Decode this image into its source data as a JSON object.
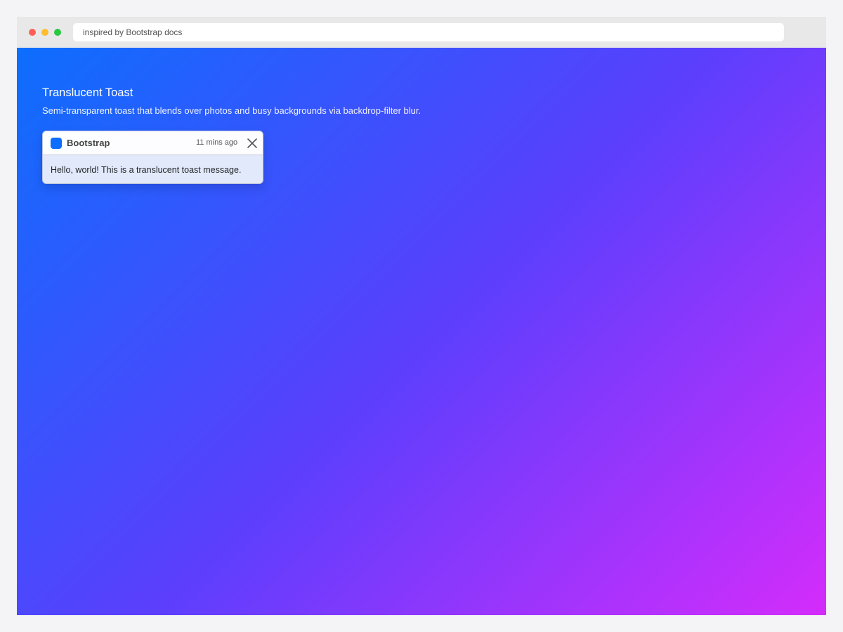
{
  "browser": {
    "url_text": "inspired by Bootstrap docs",
    "controls": {
      "close_color": "#ff5f57",
      "minimize_color": "#febc2e",
      "maximize_color": "#28c840"
    }
  },
  "page": {
    "title": "Translucent Toast",
    "description": "Semi-transparent toast that blends over photos and busy backgrounds via backdrop-filter blur.",
    "gradient_colors": [
      "#0d6efd",
      "#5a3ffd",
      "#d42cfb"
    ]
  },
  "toast": {
    "brand_color": "#0d6efd",
    "title": "Bootstrap",
    "time": "11 mins ago",
    "close_icon": "close-icon",
    "message": "Hello, world! This is a translucent toast message."
  }
}
